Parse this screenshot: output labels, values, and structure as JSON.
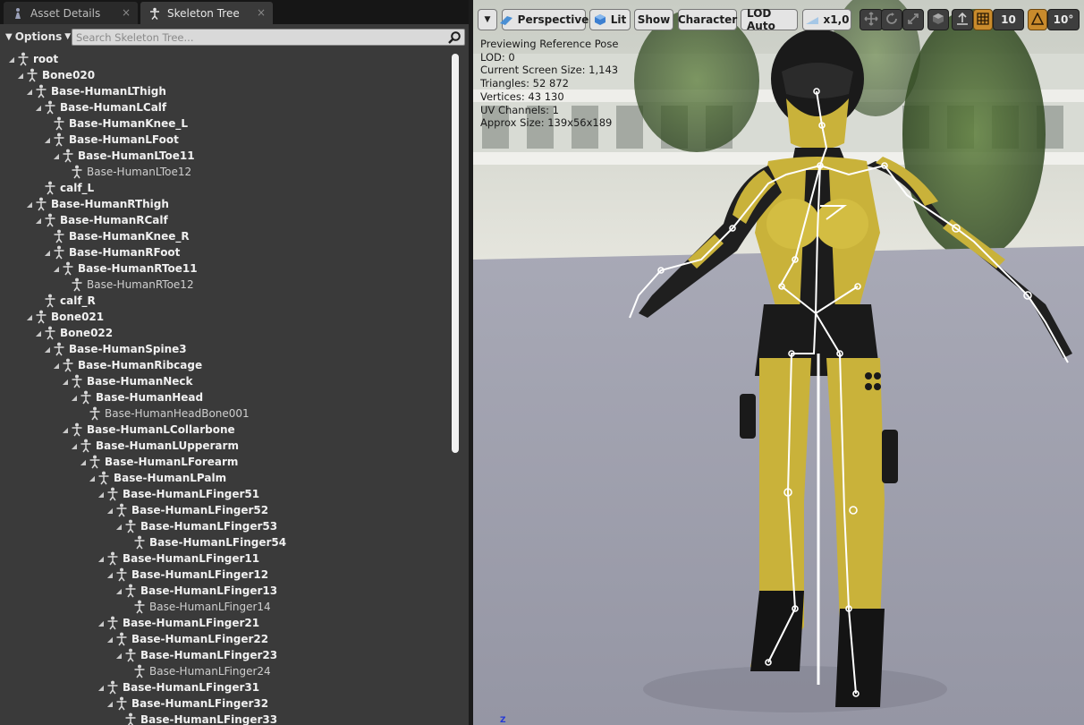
{
  "tabs": [
    {
      "label": "Asset Details",
      "icon": "character-icon",
      "active": false
    },
    {
      "label": "Skeleton Tree",
      "icon": "skeleton-icon",
      "active": true
    }
  ],
  "toolbar": {
    "options_label": "Options",
    "search_placeholder": "Search Skeleton Tree..."
  },
  "tree": [
    {
      "label": "root",
      "depth": 0,
      "bold": true
    },
    {
      "label": "Bone020",
      "depth": 1,
      "bold": true
    },
    {
      "label": "Base-HumanLThigh",
      "depth": 2,
      "bold": true
    },
    {
      "label": "Base-HumanLCalf",
      "depth": 3,
      "bold": true
    },
    {
      "label": "Base-HumanKnee_L",
      "depth": 4,
      "bold": true
    },
    {
      "label": "Base-HumanLFoot",
      "depth": 4,
      "bold": true
    },
    {
      "label": "Base-HumanLToe11",
      "depth": 5,
      "bold": true
    },
    {
      "label": "Base-HumanLToe12",
      "depth": 6,
      "bold": false
    },
    {
      "label": "calf_L",
      "depth": 3,
      "bold": true
    },
    {
      "label": "Base-HumanRThigh",
      "depth": 2,
      "bold": true
    },
    {
      "label": "Base-HumanRCalf",
      "depth": 3,
      "bold": true
    },
    {
      "label": "Base-HumanKnee_R",
      "depth": 4,
      "bold": true
    },
    {
      "label": "Base-HumanRFoot",
      "depth": 4,
      "bold": true
    },
    {
      "label": "Base-HumanRToe11",
      "depth": 5,
      "bold": true
    },
    {
      "label": "Base-HumanRToe12",
      "depth": 6,
      "bold": false
    },
    {
      "label": "calf_R",
      "depth": 3,
      "bold": true
    },
    {
      "label": "Bone021",
      "depth": 2,
      "bold": true
    },
    {
      "label": "Bone022",
      "depth": 3,
      "bold": true
    },
    {
      "label": "Base-HumanSpine3",
      "depth": 4,
      "bold": true
    },
    {
      "label": "Base-HumanRibcage",
      "depth": 5,
      "bold": true
    },
    {
      "label": "Base-HumanNeck",
      "depth": 6,
      "bold": true
    },
    {
      "label": "Base-HumanHead",
      "depth": 7,
      "bold": true
    },
    {
      "label": "Base-HumanHeadBone001",
      "depth": 8,
      "bold": false
    },
    {
      "label": "Base-HumanLCollarbone",
      "depth": 6,
      "bold": true
    },
    {
      "label": "Base-HumanLUpperarm",
      "depth": 7,
      "bold": true
    },
    {
      "label": "Base-HumanLForearm",
      "depth": 8,
      "bold": true
    },
    {
      "label": "Base-HumanLPalm",
      "depth": 9,
      "bold": true
    },
    {
      "label": "Base-HumanLFinger51",
      "depth": 10,
      "bold": true
    },
    {
      "label": "Base-HumanLFinger52",
      "depth": 11,
      "bold": true
    },
    {
      "label": "Base-HumanLFinger53",
      "depth": 12,
      "bold": true
    },
    {
      "label": "Base-HumanLFinger54",
      "depth": 13,
      "bold": true
    },
    {
      "label": "Base-HumanLFinger11",
      "depth": 10,
      "bold": true
    },
    {
      "label": "Base-HumanLFinger12",
      "depth": 11,
      "bold": true
    },
    {
      "label": "Base-HumanLFinger13",
      "depth": 12,
      "bold": true
    },
    {
      "label": "Base-HumanLFinger14",
      "depth": 13,
      "bold": false
    },
    {
      "label": "Base-HumanLFinger21",
      "depth": 10,
      "bold": true
    },
    {
      "label": "Base-HumanLFinger22",
      "depth": 11,
      "bold": true
    },
    {
      "label": "Base-HumanLFinger23",
      "depth": 12,
      "bold": true
    },
    {
      "label": "Base-HumanLFinger24",
      "depth": 13,
      "bold": false
    },
    {
      "label": "Base-HumanLFinger31",
      "depth": 10,
      "bold": true
    },
    {
      "label": "Base-HumanLFinger32",
      "depth": 11,
      "bold": true
    },
    {
      "label": "Base-HumanLFinger33",
      "depth": 12,
      "bold": true
    }
  ],
  "viewport": {
    "menu_icon": "chevron-down-icon",
    "perspective_label": "Perspective",
    "lit_label": "Lit",
    "show_label": "Show",
    "character_label": "Character",
    "lod_label": "LOD Auto",
    "speed_label": "x1,0",
    "grid_value": "10",
    "angle_value": "10°",
    "info": [
      "Previewing Reference Pose",
      "LOD: 0",
      "Current Screen Size: 1,143",
      "Triangles: 52 872",
      "Vertices: 43 130",
      "UV Channels: 1",
      "Approx Size: 139x56x189"
    ],
    "axis_label": "Z"
  },
  "colors": {
    "panel": "#3a3a3a",
    "accent_orange": "#c98b2c",
    "floor": "#9a9aa8",
    "suit_yellow": "#c9b23a"
  }
}
